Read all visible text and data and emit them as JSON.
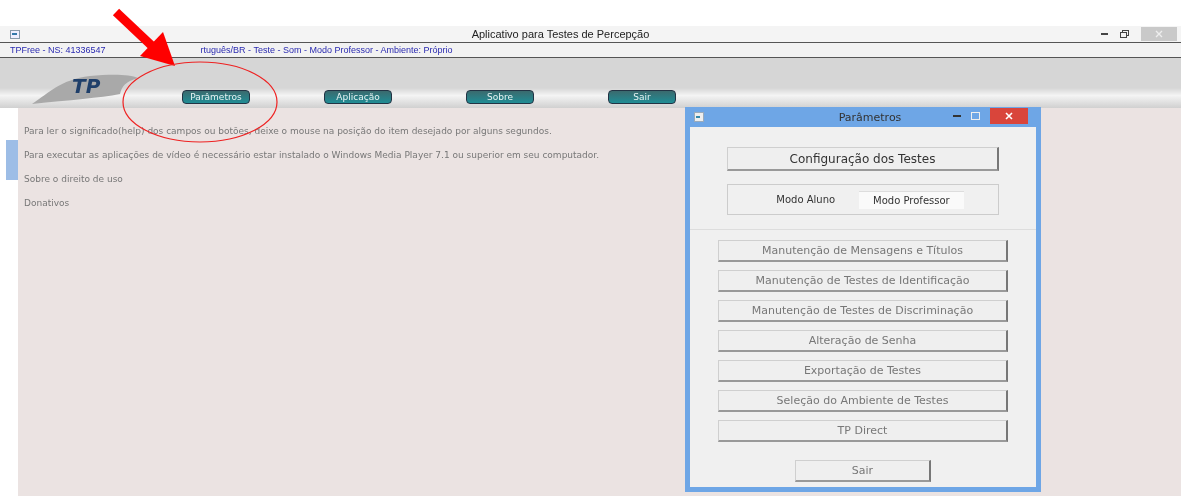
{
  "window": {
    "title": "Aplicativo para Testes de Percepção"
  },
  "status_line": {
    "before_arrow": "TPFree - NS: 41336547",
    "after_arrow": "rtuguês/BR - Teste - Som - Modo Professor - Ambiente: Próprio"
  },
  "logo": {
    "text": "TP"
  },
  "nav_buttons": [
    "Parâmetros",
    "Aplicação",
    "Sobre",
    "Sair"
  ],
  "info_lines": [
    {
      "text": "Para ler o significado(help) dos campos ou botões, deixe o mouse na posição do item desejado por alguns segundos."
    },
    {
      "text": "Para executar as aplicações de vídeo é necessário estar instalado o Windows Media Player 7.1 ou superior em seu computador."
    },
    {
      "text": "Sobre o direito de uso"
    },
    {
      "text": "Donativos"
    }
  ],
  "dialog": {
    "title": "Parâmetros",
    "config_button": "Configuração dos Testes",
    "modes": [
      {
        "label": "Modo Aluno",
        "selected": false
      },
      {
        "label": "Modo Professor",
        "selected": true
      }
    ],
    "buttons": [
      "Manutenção de Mensagens e Títulos",
      "Manutenção de Testes de Identificação",
      "Manutenção de Testes de Discriminação",
      "Alteração de Senha",
      "Exportação de Testes",
      "Seleção do Ambiente de Testes",
      "TP Direct"
    ],
    "exit_button": "Sair"
  }
}
